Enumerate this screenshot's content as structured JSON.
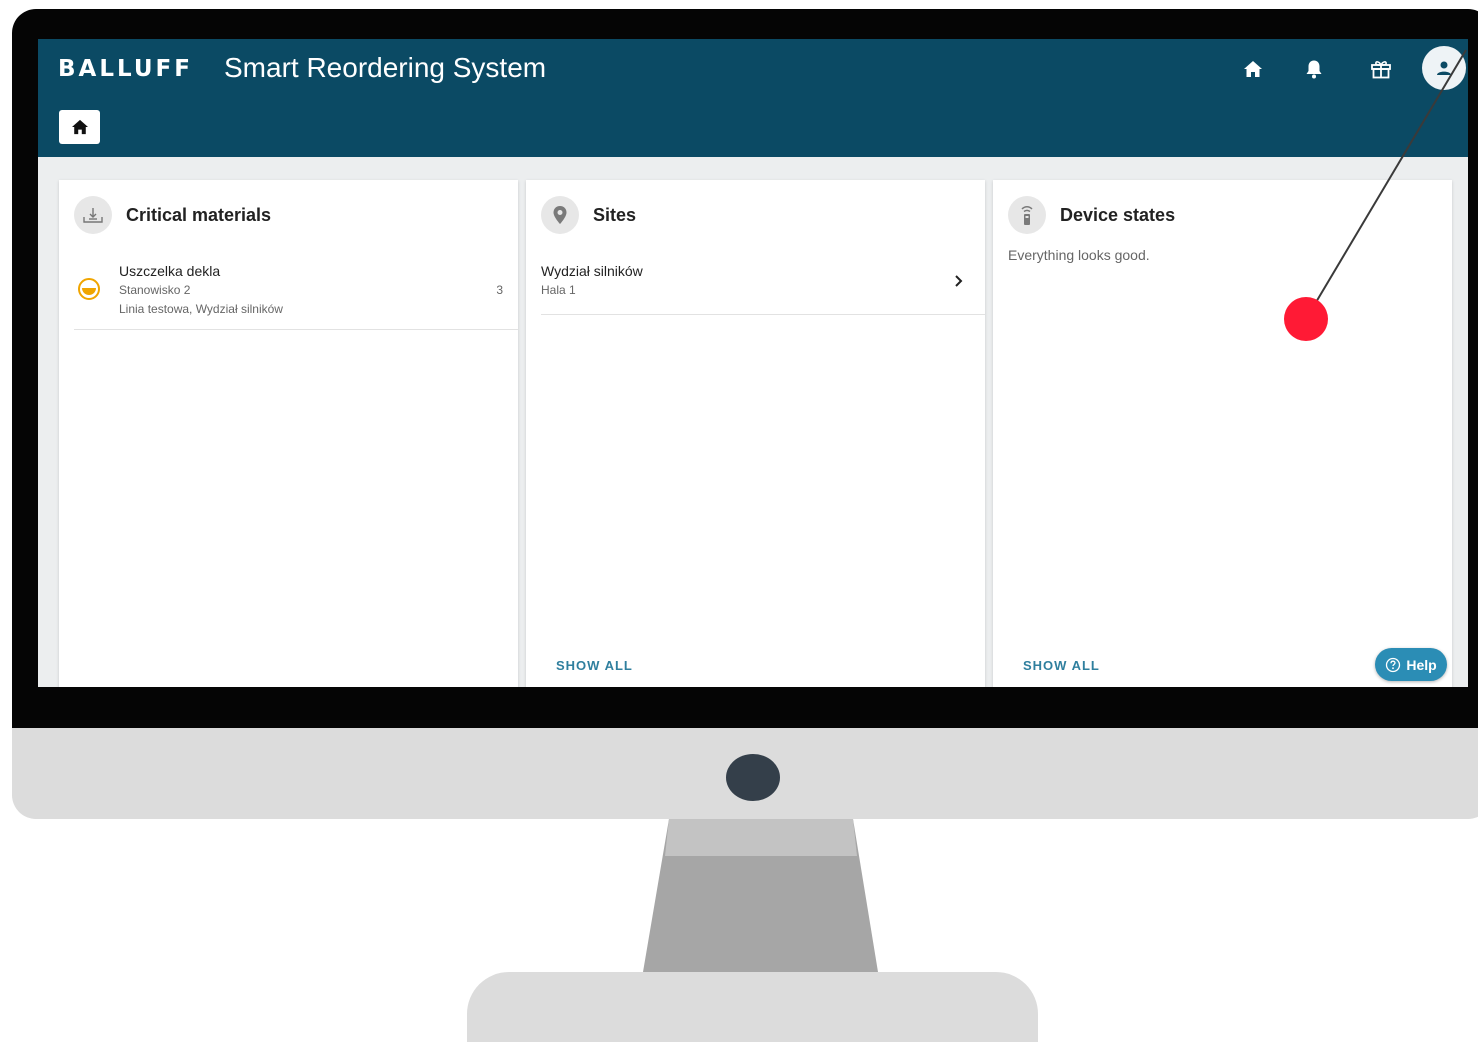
{
  "header": {
    "brand": "BALLUFF",
    "title": "Smart Reordering System",
    "colors": {
      "topbar": "#0b4a64",
      "accent": "#2f7f9e"
    }
  },
  "toolbar": {
    "icons": [
      "home-icon",
      "bell-icon",
      "gift-icon",
      "user-avatar-icon"
    ]
  },
  "breadcrumb": {
    "icon": "home-icon"
  },
  "cards": {
    "critical": {
      "title": "Critical materials",
      "icon": "inbox-download-icon",
      "items": [
        {
          "name": "Uszczelka dekla",
          "station": "Stanowisko 2",
          "location": "Linia testowa, Wydział silników",
          "count": "3",
          "status_color": "#f0a500"
        }
      ]
    },
    "sites": {
      "title": "Sites",
      "icon": "map-pin-icon",
      "items": [
        {
          "name": "Wydział silników",
          "hall": "Hala 1"
        }
      ],
      "show_all": "SHOW ALL"
    },
    "devices": {
      "title": "Device states",
      "icon": "wireless-sensor-icon",
      "message": "Everything looks good.",
      "show_all": "SHOW ALL"
    }
  },
  "help": {
    "label": "Help"
  }
}
